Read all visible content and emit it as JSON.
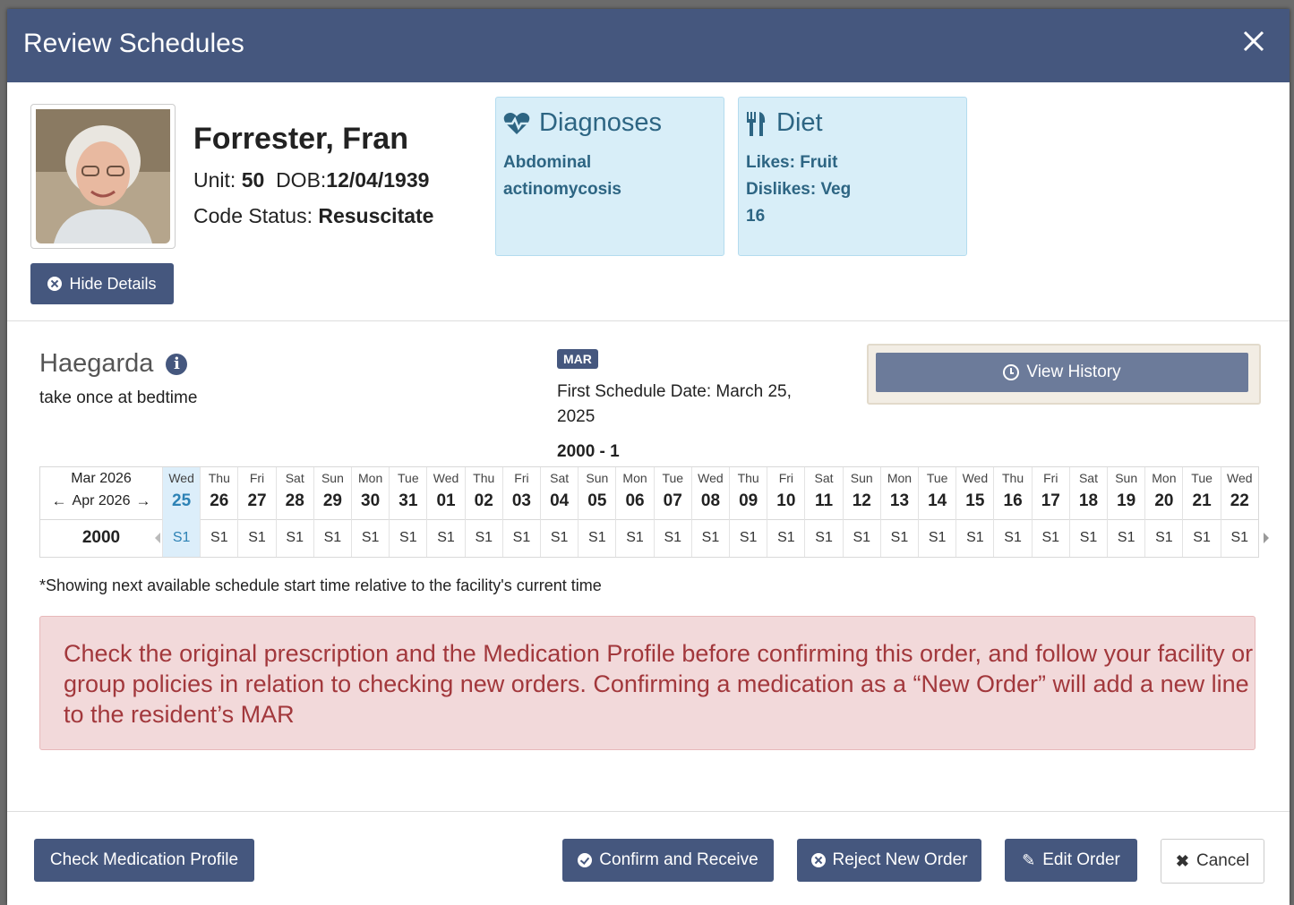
{
  "modal": {
    "title": "Review Schedules"
  },
  "resident": {
    "name": "Forrester, Fran",
    "unit_label": "Unit:",
    "unit": "50",
    "dob_label": "DOB:",
    "dob": "12/04/1939",
    "code_label": "Code Status:",
    "code_status": "Resuscitate"
  },
  "hide_details_label": "Hide Details",
  "diagnoses": {
    "title": "Diagnoses",
    "value": "Abdominal actinomycosis"
  },
  "diet": {
    "title": "Diet",
    "likes_label": "Likes:",
    "likes": "Fruit",
    "dislikes_label": "Dislikes:",
    "dislikes": "Veg",
    "extra": "16"
  },
  "medication": {
    "name": "Haegarda",
    "instruction": "take once at bedtime",
    "badge": "MAR",
    "first_schedule": "First Schedule Date: March 25, 2025",
    "dose_time": "2000 - 1"
  },
  "view_history_label": "View History",
  "schedule": {
    "month_from": "Mar 2026",
    "month_to": "Apr 2026",
    "time": "2000",
    "days": [
      {
        "dow": "Wed",
        "date": "25",
        "slot": "S1"
      },
      {
        "dow": "Thu",
        "date": "26",
        "slot": "S1"
      },
      {
        "dow": "Fri",
        "date": "27",
        "slot": "S1"
      },
      {
        "dow": "Sat",
        "date": "28",
        "slot": "S1"
      },
      {
        "dow": "Sun",
        "date": "29",
        "slot": "S1"
      },
      {
        "dow": "Mon",
        "date": "30",
        "slot": "S1"
      },
      {
        "dow": "Tue",
        "date": "31",
        "slot": "S1"
      },
      {
        "dow": "Wed",
        "date": "01",
        "slot": "S1"
      },
      {
        "dow": "Thu",
        "date": "02",
        "slot": "S1"
      },
      {
        "dow": "Fri",
        "date": "03",
        "slot": "S1"
      },
      {
        "dow": "Sat",
        "date": "04",
        "slot": "S1"
      },
      {
        "dow": "Sun",
        "date": "05",
        "slot": "S1"
      },
      {
        "dow": "Mon",
        "date": "06",
        "slot": "S1"
      },
      {
        "dow": "Tue",
        "date": "07",
        "slot": "S1"
      },
      {
        "dow": "Wed",
        "date": "08",
        "slot": "S1"
      },
      {
        "dow": "Thu",
        "date": "09",
        "slot": "S1"
      },
      {
        "dow": "Fri",
        "date": "10",
        "slot": "S1"
      },
      {
        "dow": "Sat",
        "date": "11",
        "slot": "S1"
      },
      {
        "dow": "Sun",
        "date": "12",
        "slot": "S1"
      },
      {
        "dow": "Mon",
        "date": "13",
        "slot": "S1"
      },
      {
        "dow": "Tue",
        "date": "14",
        "slot": "S1"
      },
      {
        "dow": "Wed",
        "date": "15",
        "slot": "S1"
      },
      {
        "dow": "Thu",
        "date": "16",
        "slot": "S1"
      },
      {
        "dow": "Fri",
        "date": "17",
        "slot": "S1"
      },
      {
        "dow": "Sat",
        "date": "18",
        "slot": "S1"
      },
      {
        "dow": "Sun",
        "date": "19",
        "slot": "S1"
      },
      {
        "dow": "Mon",
        "date": "20",
        "slot": "S1"
      },
      {
        "dow": "Tue",
        "date": "21",
        "slot": "S1"
      },
      {
        "dow": "Wed",
        "date": "22",
        "slot": "S1"
      }
    ]
  },
  "note": "*Showing next available schedule start time relative to the facility's current time",
  "warning": "Check the original prescription and the Medication Profile before confirming this order, and follow your facility or group policies in relation to checking new orders. Confirming a medication as a “New Order” will add a new line to the resident’s MAR",
  "footer": {
    "check_profile": "Check Medication Profile",
    "confirm": "Confirm and Receive",
    "reject": "Reject New Order",
    "edit": "Edit Order",
    "cancel": "Cancel"
  },
  "colors": {
    "header": "#45577e",
    "info_card": "#d8eef8",
    "warning_bg": "#f2d9da",
    "warning_text": "#a2383c",
    "today": "#dceefa"
  }
}
